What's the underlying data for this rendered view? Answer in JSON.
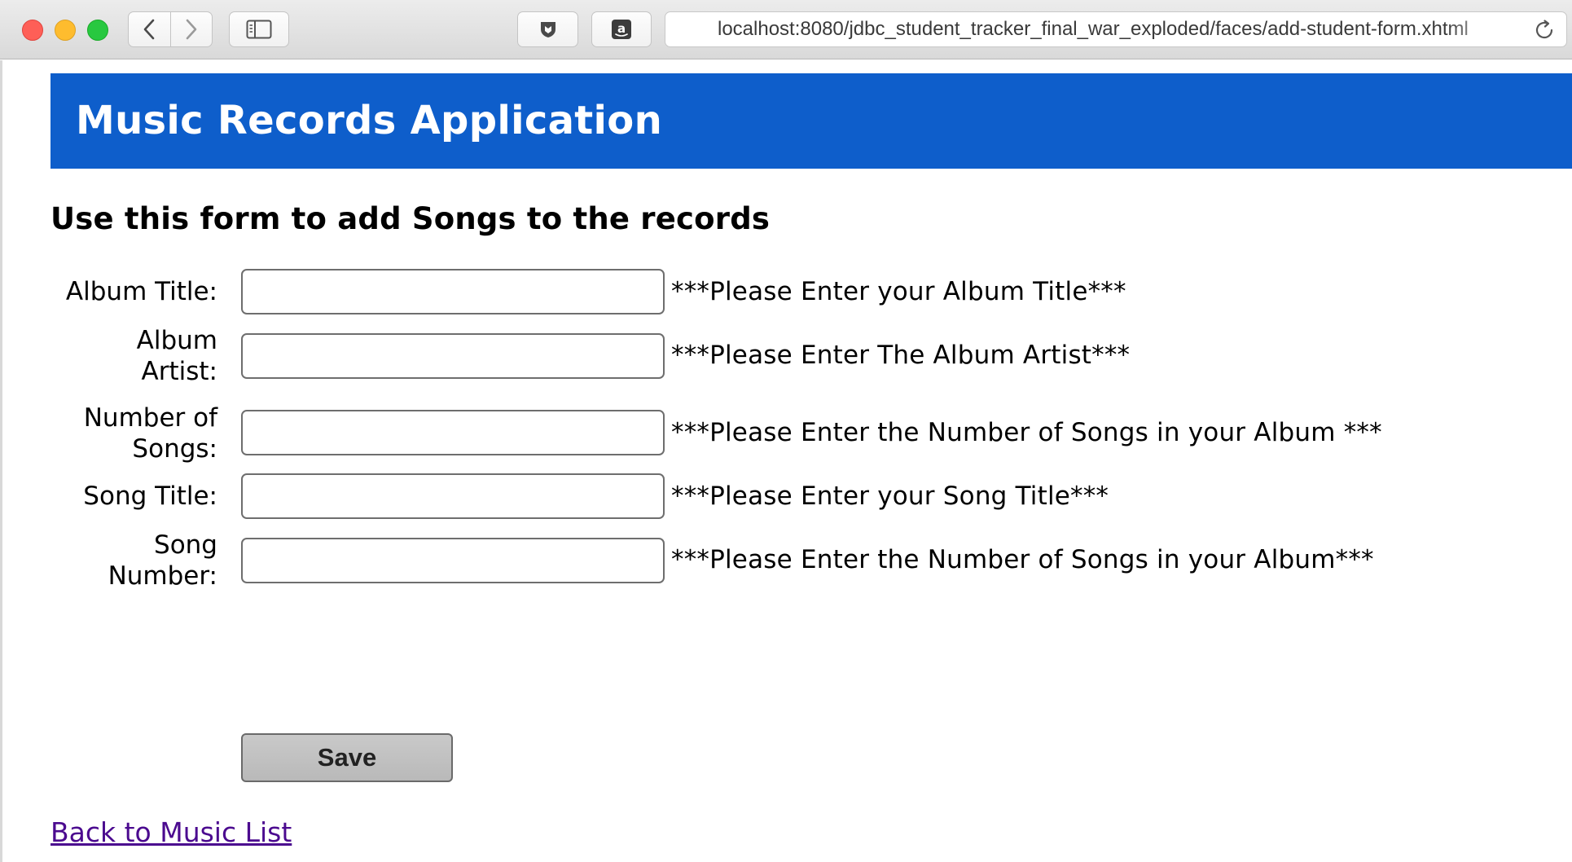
{
  "browser": {
    "url": "localhost:8080/jdbc_student_tracker_final_war_exploded/faces/add-student-form.xhtml",
    "icons": {
      "back": "chevron-left-icon",
      "forward": "chevron-right-icon",
      "sidebar": "sidebar-icon",
      "reader": "shield-icon",
      "amazon": "amazon-icon",
      "reload": "reload-icon"
    }
  },
  "header": {
    "title": "Music Records Application",
    "background": "#0e5ecb"
  },
  "form": {
    "heading": "Use this form to add Songs to the records",
    "fields": [
      {
        "label": "Album Title:",
        "value": "",
        "hint": "***Please Enter your Album Title***"
      },
      {
        "label_lines": [
          "Album",
          "Artist:"
        ],
        "value": "",
        "hint": "***Please Enter The Album Artist***"
      },
      {
        "label_lines": [
          "Number of",
          "Songs:"
        ],
        "value": "",
        "hint": "***Please Enter the Number of Songs in your Album ***"
      },
      {
        "label": "Song Title:",
        "value": "",
        "hint": "***Please Enter your Song Title***"
      },
      {
        "label_lines": [
          "Song",
          "Number:"
        ],
        "value": "",
        "hint": "***Please Enter the Number of Songs in your Album***"
      }
    ],
    "save_label": "Save"
  },
  "footer": {
    "back_link": "Back to Music List"
  }
}
